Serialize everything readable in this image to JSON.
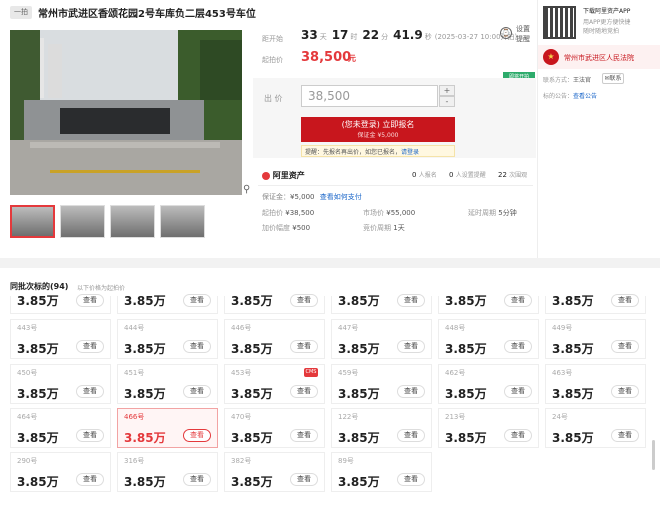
{
  "header": {
    "badge": "一拍",
    "title": "常州市武进区香颂花园2号车库负二层453号车位"
  },
  "countdown": {
    "label": "距开始",
    "d": "33",
    "d_unit": "天",
    "h": "17",
    "h_unit": "时",
    "m": "22",
    "m_unit": "分",
    "s": "41.9",
    "s_unit": "秒",
    "date": "(2025-03-27 10:00开拍)"
  },
  "reminder": {
    "line1": "设置",
    "line2": "提醒"
  },
  "start_price": {
    "label": "起拍价",
    "value": "38,500",
    "unit": "元"
  },
  "badge_small": "即将开拍",
  "bid": {
    "label": "出 价",
    "value": "38,500",
    "plus": "+",
    "minus": "-"
  },
  "register": {
    "line1": "(您未登录) 立即报名",
    "line2": "保证金 ¥5,000"
  },
  "tip": {
    "prefix": "提醒：先报名再出价，如您已报名，",
    "link": "请登录"
  },
  "brand": "阿里资产",
  "stats": [
    {
      "num": "0",
      "label": "人报名"
    },
    {
      "num": "0",
      "label": "人设置提醒"
    },
    {
      "num": "22",
      "label": "次围观"
    }
  ],
  "info": {
    "deposit_label": "保证金：",
    "deposit": "¥5,000",
    "deposit_link": "查看如何支付",
    "r1": [
      {
        "k": "起拍价",
        "v": "¥38,500"
      },
      {
        "k": "市场价",
        "v": "¥55,000"
      },
      {
        "k": "延时周期",
        "v": "5分钟"
      }
    ],
    "r2": [
      {
        "k": "加价幅度",
        "v": "¥500"
      },
      {
        "k": "竞价周期",
        "v": "1天"
      }
    ]
  },
  "app": {
    "title": "下载阿里资产APP",
    "line1": "用APP更方便快捷",
    "line2": "随时随地竞拍"
  },
  "court": {
    "name": "常州市武进区人民法院",
    "contact_label": "联系方式：",
    "contact_name": "王法官",
    "contact_btn": "联系",
    "notice_label": "标的公告：",
    "notice_link": "查看公告"
  },
  "batch": {
    "title": "同批次标的(94)",
    "sub": "以下价格为起拍价"
  },
  "grid": {
    "btn": "查看",
    "tag": "CMS",
    "partial": [
      "3.85万",
      "3.85万",
      "3.85万",
      "3.85万",
      "3.85万",
      "3.85万"
    ],
    "rows": [
      [
        {
          "lot": "443号",
          "price": "3.85万"
        },
        {
          "lot": "444号",
          "price": "3.85万"
        },
        {
          "lot": "446号",
          "price": "3.85万"
        },
        {
          "lot": "447号",
          "price": "3.85万"
        },
        {
          "lot": "448号",
          "price": "3.85万"
        },
        {
          "lot": "449号",
          "price": "3.85万"
        }
      ],
      [
        {
          "lot": "450号",
          "price": "3.85万"
        },
        {
          "lot": "451号",
          "price": "3.85万"
        },
        {
          "lot": "453号",
          "price": "3.85万"
        },
        {
          "lot": "459号",
          "price": "3.85万"
        },
        {
          "lot": "462号",
          "price": "3.85万"
        },
        {
          "lot": "463号",
          "price": "3.85万"
        }
      ],
      [
        {
          "lot": "464号",
          "price": "3.85万"
        },
        {
          "lot": "466号",
          "price": "3.85万"
        },
        {
          "lot": "470号",
          "price": "3.85万"
        },
        {
          "lot": "122号",
          "price": "3.85万"
        },
        {
          "lot": "213号",
          "price": "3.85万"
        },
        {
          "lot": "24号",
          "price": "3.85万"
        }
      ],
      [
        {
          "lot": "290号",
          "price": "3.85万"
        },
        {
          "lot": "316号",
          "price": "3.85万"
        },
        {
          "lot": "382号",
          "price": "3.85万"
        },
        {
          "lot": "89号",
          "price": "3.85万"
        }
      ]
    ]
  }
}
